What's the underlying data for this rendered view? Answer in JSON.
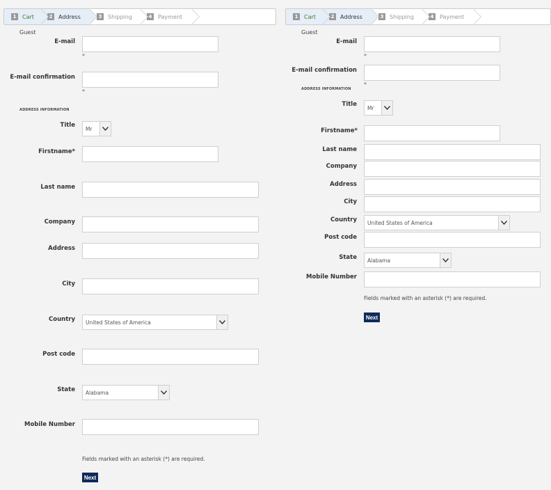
{
  "steps": [
    {
      "num": "1",
      "label": "Cart",
      "state": "done"
    },
    {
      "num": "2",
      "label": "Address",
      "state": "active"
    },
    {
      "num": "3",
      "label": "Shipping",
      "state": "todo"
    },
    {
      "num": "4",
      "label": "Payment",
      "state": "todo"
    }
  ],
  "form": {
    "guest_label": "Guest",
    "email_label": "E-mail",
    "email_value": "",
    "required_dot": "*",
    "email_confirm_label": "E-mail confirmation",
    "email_confirm_value": "",
    "address_section": "ADDRESS INFORMATION",
    "title_label": "Title",
    "title_value": "Mr",
    "firstname_label": "Firstname*",
    "lastname_label": "Last name",
    "company_label": "Company",
    "address_label": "Address",
    "city_label": "City",
    "country_label": "Country",
    "country_value": "United States of America",
    "postcode_label": "Post code",
    "state_label": "State",
    "state_value": "Alabama",
    "mobile_label": "Mobile Number",
    "required_note": "Fields marked with an asterisk (*) are required.",
    "next_label": "Next"
  }
}
